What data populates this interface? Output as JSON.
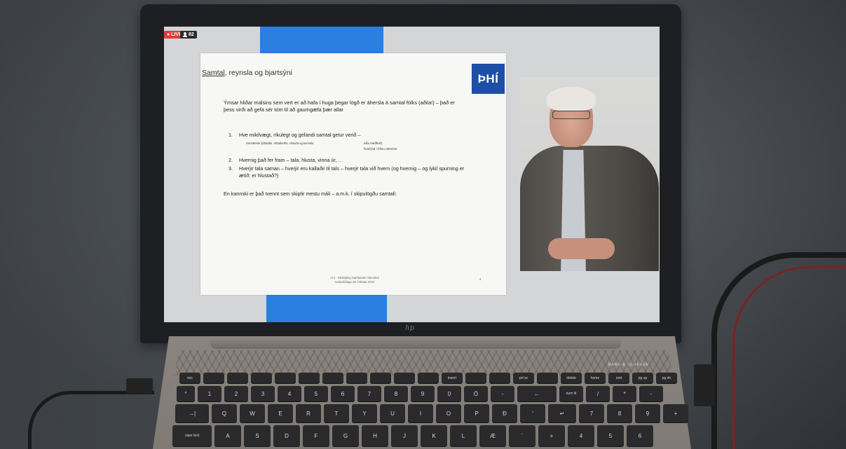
{
  "stream": {
    "live_badge": "● LIVE",
    "viewer_count": "82"
  },
  "slide": {
    "title_underlined": "Samtal",
    "title_rest": ", reynsla og bjartsýni",
    "logo_text": "ÞHÍ",
    "intro": "Ýmsar hliðar málsins sem vert er að hafa í huga þegar lögð er áhersla á samtal fólks (aðila!) – það er þess virði að gefa sér tóm til að gaumgæfa þær allar",
    "list": [
      {
        "num": "1.",
        "text": "Hve mikilvægt, ríkulegt og gefandi samtal getur verið –"
      },
      {
        "num": "2.",
        "text": "Hvernig það fer fram – tala, hlusta, vinna úr, …"
      },
      {
        "num": "3.",
        "text": "Hverjir tala saman – hverjir eru kallaðir til tals – hverjir tala við hvern (og hvernig – og lykil spurning er ætíð: er hlustað?)"
      }
    ],
    "sub_left": "Hornsteinn lýðræðis, réttarkerfis, vísinda og kennslu",
    "sub_right_line1": "eða meðferð,",
    "sub_right_line2": "hvað þá í lífinu almennt",
    "conclusion": "En kannski er það tvennt sem skiptir mestu máli – a.m.k. í skipulögðu samtali:",
    "footer_line1": "JTJ - Skólaþing Sambands íslenskra",
    "footer_line2": "sveitarfélaga 28. febrúar 2022",
    "page_number": "4"
  },
  "laptop": {
    "brand_logo": "hp",
    "speaker_label": "BANG & OLUFSEN"
  },
  "keyboard": {
    "row_fn": [
      "esc",
      "",
      "",
      "",
      "",
      "",
      "",
      "",
      "",
      "",
      "",
      "insert",
      "",
      "",
      "prt sc",
      "",
      "delete",
      "home",
      "end",
      "pg up",
      "pg dn"
    ],
    "row_num": [
      "°",
      "1",
      "2",
      "3",
      "4",
      "5",
      "6",
      "7",
      "8",
      "9",
      "0",
      "Ö",
      "-",
      "←",
      "num lk",
      "/",
      "*",
      "-"
    ],
    "row_q": [
      "→|",
      "Q",
      "W",
      "E",
      "R",
      "T",
      "Y",
      "U",
      "I",
      "O",
      "P",
      "Ð",
      "'",
      "↵",
      "7",
      "8",
      "9",
      "+"
    ],
    "row_a": [
      "caps lock",
      "A",
      "S",
      "D",
      "F",
      "G",
      "H",
      "J",
      "K",
      "L",
      "Æ",
      "´",
      "+",
      "4",
      "5",
      "6"
    ]
  }
}
